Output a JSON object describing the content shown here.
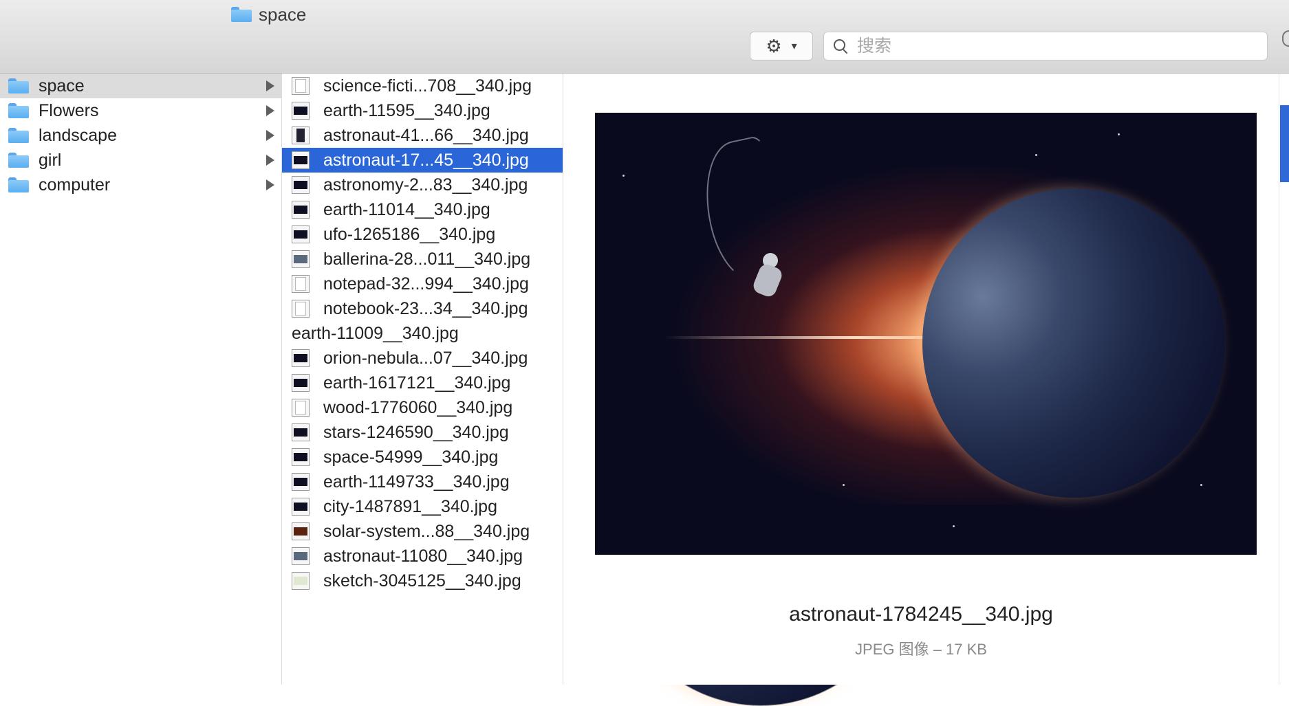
{
  "window": {
    "title": "space"
  },
  "toolbar": {
    "action_icon": "gear-icon",
    "search_placeholder": "搜索"
  },
  "sidebar": {
    "items": [
      {
        "label": "space",
        "selected": true
      },
      {
        "label": "Flowers",
        "selected": false
      },
      {
        "label": "landscape",
        "selected": false
      },
      {
        "label": "girl",
        "selected": false
      },
      {
        "label": "computer",
        "selected": false
      }
    ]
  },
  "files": [
    {
      "name": "science-ficti...708__340.jpg",
      "thumb": "doc",
      "selected": false
    },
    {
      "name": "earth-11595__340.jpg",
      "thumb": "dark",
      "selected": false
    },
    {
      "name": "astronaut-41...66__340.jpg",
      "thumb": "tall",
      "selected": false
    },
    {
      "name": "astronaut-17...45__340.jpg",
      "thumb": "dark",
      "selected": true
    },
    {
      "name": "astronomy-2...83__340.jpg",
      "thumb": "dark",
      "selected": false
    },
    {
      "name": "earth-11014__340.jpg",
      "thumb": "dark",
      "selected": false
    },
    {
      "name": "ufo-1265186__340.jpg",
      "thumb": "dark",
      "selected": false
    },
    {
      "name": "ballerina-28...011__340.jpg",
      "thumb": "photo",
      "selected": false
    },
    {
      "name": "notepad-32...994__340.jpg",
      "thumb": "doc",
      "selected": false
    },
    {
      "name": "notebook-23...34__340.jpg",
      "thumb": "doc",
      "selected": false
    },
    {
      "name": "earth-11009__340.jpg",
      "thumb": "earth",
      "selected": false
    },
    {
      "name": "orion-nebula...07__340.jpg",
      "thumb": "dark",
      "selected": false
    },
    {
      "name": "earth-1617121__340.jpg",
      "thumb": "dark",
      "selected": false
    },
    {
      "name": "wood-1776060__340.jpg",
      "thumb": "doc",
      "selected": false
    },
    {
      "name": "stars-1246590__340.jpg",
      "thumb": "dark",
      "selected": false
    },
    {
      "name": "space-54999__340.jpg",
      "thumb": "dark",
      "selected": false
    },
    {
      "name": "earth-1149733__340.jpg",
      "thumb": "dark",
      "selected": false
    },
    {
      "name": "city-1487891__340.jpg",
      "thumb": "dark",
      "selected": false
    },
    {
      "name": "solar-system...88__340.jpg",
      "thumb": "solar",
      "selected": false
    },
    {
      "name": "astronaut-11080__340.jpg",
      "thumb": "photo",
      "selected": false
    },
    {
      "name": "sketch-3045125__340.jpg",
      "thumb": "sketch",
      "selected": false
    }
  ],
  "preview": {
    "filename": "astronaut-1784245__340.jpg",
    "meta": "JPEG 图像 – 17 KB"
  },
  "colors": {
    "selection_blue": "#2a66d8",
    "sidebar_selected": "#dcdcdc"
  }
}
